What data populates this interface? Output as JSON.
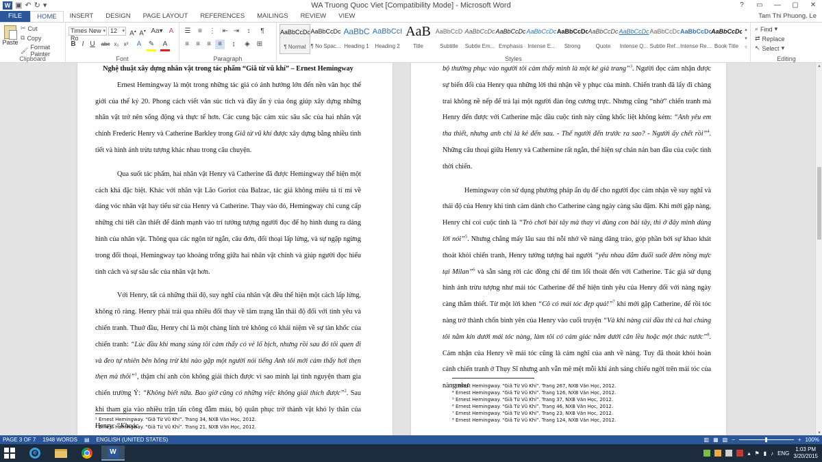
{
  "window": {
    "title": "WA Truong Quoc Viet [Compatibility Mode] - Microsoft Word",
    "user": "Tam Thi Phuong. Le",
    "controls": [
      "?",
      "▭",
      "—",
      "▢",
      "✕"
    ]
  },
  "tabs": [
    "FILE",
    "HOME",
    "INSERT",
    "DESIGN",
    "PAGE LAYOUT",
    "REFERENCES",
    "MAILINGS",
    "REVIEW",
    "VIEW"
  ],
  "clipboard": {
    "paste": "Paste",
    "cut": "Cut",
    "copy": "Copy",
    "format_painter": "Format Painter",
    "label": "Clipboard"
  },
  "font": {
    "name": "Times New Ro",
    "size": "12",
    "label": "Font",
    "buttons": [
      "B",
      "I",
      "U",
      "abc",
      "x₂",
      "x²"
    ]
  },
  "paragraph": {
    "label": "Paragraph"
  },
  "styles": {
    "label": "Styles",
    "items": [
      {
        "sample": "AaBbCcDc",
        "name": "¶ Normal"
      },
      {
        "sample": "AaBbCcDc",
        "name": "¶ No Spac..."
      },
      {
        "sample": "AaBbC",
        "name": "Heading 1"
      },
      {
        "sample": "AaBbCcI",
        "name": "Heading 2"
      },
      {
        "sample": "AaB",
        "name": "Title"
      },
      {
        "sample": "AaBbCcD",
        "name": "Subtitle"
      },
      {
        "sample": "AaBbCcDc",
        "name": "Subtle Em..."
      },
      {
        "sample": "AaBbCcDc",
        "name": "Emphasis"
      },
      {
        "sample": "AaBbCcDc",
        "name": "Intense E..."
      },
      {
        "sample": "AaBbCcDc",
        "name": "Strong"
      },
      {
        "sample": "AaBbCcDc",
        "name": "Quote"
      },
      {
        "sample": "AaBbCcDc",
        "name": "Intense Q..."
      },
      {
        "sample": "AaBbCcDc",
        "name": "Subtle Ref..."
      },
      {
        "sample": "AaBbCcDc",
        "name": "Intense Re..."
      },
      {
        "sample": "AaBbCcDc",
        "name": "Book Title"
      }
    ]
  },
  "editing": {
    "find": "Find",
    "replace": "Replace",
    "select": "Select",
    "label": "Editing"
  },
  "page1": {
    "heading": "Nghệ thuật xây dựng nhân vật trong tác phẩm “Giã từ vũ khí” – Ernest Hemingway",
    "p1": "Ernest Hemingway là một trong những tác giả có ảnh hưởng lớn đến nền văn học thế giới của thế kỷ 20. Phong cách viết văn súc tích và đầy ẩn ý của ông giúp xây dựng những nhân vật trở nên sống động và thực tế hơn. Các cung bậc cảm xúc sâu sắc của hai nhân vật chính Frederic Henry và Catherine Barkley trong ",
    "p1_title": "Giã từ vũ khí",
    "p1_end": " được xây dựng bằng nhiều tình tiết và hình ảnh trừu tượng khác nhau trong câu chuyện.",
    "p2": "Qua suốt tác phẩm, hai nhân vật Henry và Catherine đã được Hemingway thể hiện một cách khá đặc biệt. Khác với nhân vật Lão Goriot của Balzac, tác giả không miêu tả tỉ mỉ về dáng vóc nhân vật hay tiểu sử của Henry và Catherine. Thay vào đó, Hemingway chỉ cung cấp những chi tiết cần thiết để đánh mạnh vào trí tưởng tượng người đọc để họ hình dung ra dáng hình của nhân vật. Thông qua các ngôn từ ngắn, câu đơn, đối thoại lấp lửng, và sự ngập ngừng trong đối thoại, Hemingway tạo khoảng trống giữa hai nhân vật chính và giúp người đọc hiểu tính cách và sự sâu sắc của nhân vật hơn.",
    "p3_a": "Với Henry, tất cả những thái độ, suy nghĩ của nhân vật đều thể hiện một cách lấp lửng, không rõ ràng. Henry phải trải qua nhiều đổi thay về tâm trạng lẫn thái độ đối với tình yêu và chiến tranh. Thuở đầu, Henry chỉ là một chàng lính trẻ không có khái niệm về sự tàn khốc của chiến tranh: ",
    "p3_q1": "“Lúc đầu khi mang súng tôi cảm thấy có vẻ lố bịch, nhưng rồi sau đó tôi quen đi và đeo tự nhiên bên hông trừ khi nào gặp một người nói tiếng Anh tôi mới cảm thấy hơi thẹn thẹn mà thôi”",
    "p3_fn1": "1",
    "p3_b": ", thậm chí anh còn không giải thích được vì sao mình lại tình nguyện tham gia chiến trường Ý: ",
    "p3_q2": "“Không biết nữa. Bao giờ cũng có những việc không giải thích được”",
    "p3_fn2": "2",
    "p3_c": ". Sau khi tham gia vào nhiều trận tấn công đẫm máu, bộ quân phục trở thành vật khó ly thân của Henry: ",
    "p3_q3": "“Khoác",
    "footnotes": [
      "¹ Ernest Hemingway. “Giã Từ Vũ Khí”. Trang 34, NXB Văn Học, 2012.",
      "² Ernest Hemingway. “Giã Từ Vũ Khí”. Trang 21, NXB Văn Học, 2012."
    ]
  },
  "page2": {
    "c1_q": "bộ thường phục vào người tôi cảm thấy mình là một kẻ giả trang”",
    "c1_fn": "3",
    "c1": ". Người đọc cảm nhận được sự biến đổi của Henry qua những lời thú nhận về y phục của mình. Chiến tranh đã lấy đi chàng trai không nề nếp để trả lại một người đàn ông cương trực. Nhưng cũng “nhờ” chiến tranh mà Henry đến được với Catherine mặc dầu cuộc tình này cũng khốc liệt không kém: ",
    "c1_q2": "“Anh yêu em tha thiết, nhưng anh chỉ là kẻ đến sau. - Thế người đến trước ra sao? - Người ấy chết rồi”",
    "c1_fn2": "4",
    "c1_end": ". Những câu thoại giữa Henry và Cathernine rất ngắn, thể hiện sự chán nản ban đầu của cuộc tình thời chiến.",
    "p4_a": "Hemingway còn sử dụng phương pháp ẩn dụ để cho người đọc cảm nhận về suy nghĩ và thái độ của Henry khi tình cảm dành cho Catherine càng ngày càng sâu đậm. Khi mới gặp nàng, Henry chỉ coi cuộc tình là ",
    "p4_q1": "“Trò chơi bài tây mà thay vì dùng con bài tây, thì ở đây mình dùng lời nói”",
    "p4_fn1": "5",
    "p4_b": ". Nhưng chẳng mấy lâu sau thì nỗi nhớ về nàng dâng trào, góp phần bởi sự khao khát thoát khỏi chiến tranh, Henry tưởng tượng hai người ",
    "p4_q2": "“yêu nhau đắm đuối suốt đêm nồng mực tại Milan”",
    "p4_fn2": "6",
    "p4_c": " và sẵn sàng rời các đồng chí để tìm lối thoát đến với Catherine. Tác giả sử dụng hình ảnh trừu tượng như mái tóc Catherine để thể hiện tình yêu của Henry đối với nàng ngày càng thắm thiết. Từ một lời khen ",
    "p4_q3": "“Cô có mái tóc đẹp quá!”",
    "p4_fn3": "7",
    "p4_d": " khi mới gặp Catherine, để rồi tóc nàng trở thành chốn bình yên của Henry vào cuối truyện ",
    "p4_q4": "“Và khi nàng cúi đầu thì cả hai chúng tôi nằm kín dưới mái tóc nàng, làm tôi có cảm giác nằm dưới căn lều hoặc một thác nước”",
    "p4_fn4": "8",
    "p4_e": ". Cảm nhận của Henry về mái tóc cũng là cảm nghĩ của anh về nàng. Tuy đã thoát khỏi hoàn cảnh chiến tranh ở Thụy Sĩ nhưng anh vẫn mê mệt mỗi khi ánh sáng chiếu ngời trên mái tóc của nàng như",
    "footnotes": [
      "³ Ernest Hemingway. “Giã Từ Vũ Khí”. Trang 267, NXB Văn Học, 2012.",
      "⁴ Ernest Hemingway. “Giã Từ Vũ Khí”. Trang 126, NXB Văn Học, 2012.",
      "⁵ Ernest Hemingway. “Giã Từ Vũ Khí”. Trang 37, NXB Văn Học, 2012.",
      "⁶ Ernest Hemingway. “Giã Từ Vũ Khí”. Trang 46, NXB Văn Học, 2012.",
      "⁷ Ernest Hemingway. “Giã Từ Vũ Khí”. Trang 23, NXB Văn Học, 2012.",
      "⁸ Ernest Hemingway. “Giã Từ Vũ Khí”. Trang 124, NXB Văn Học, 2012."
    ]
  },
  "statusbar": {
    "page": "PAGE 3 OF 7",
    "words": "1948 WORDS",
    "language": "ENGLISH (UNITED STATES)",
    "zoom": "100%"
  },
  "taskbar": {
    "lang": "ENG",
    "time": "1:03 PM",
    "date": "3/20/2015"
  },
  "colors": {
    "accent": "#2b579a",
    "taskbar": "#1c2c3c"
  }
}
